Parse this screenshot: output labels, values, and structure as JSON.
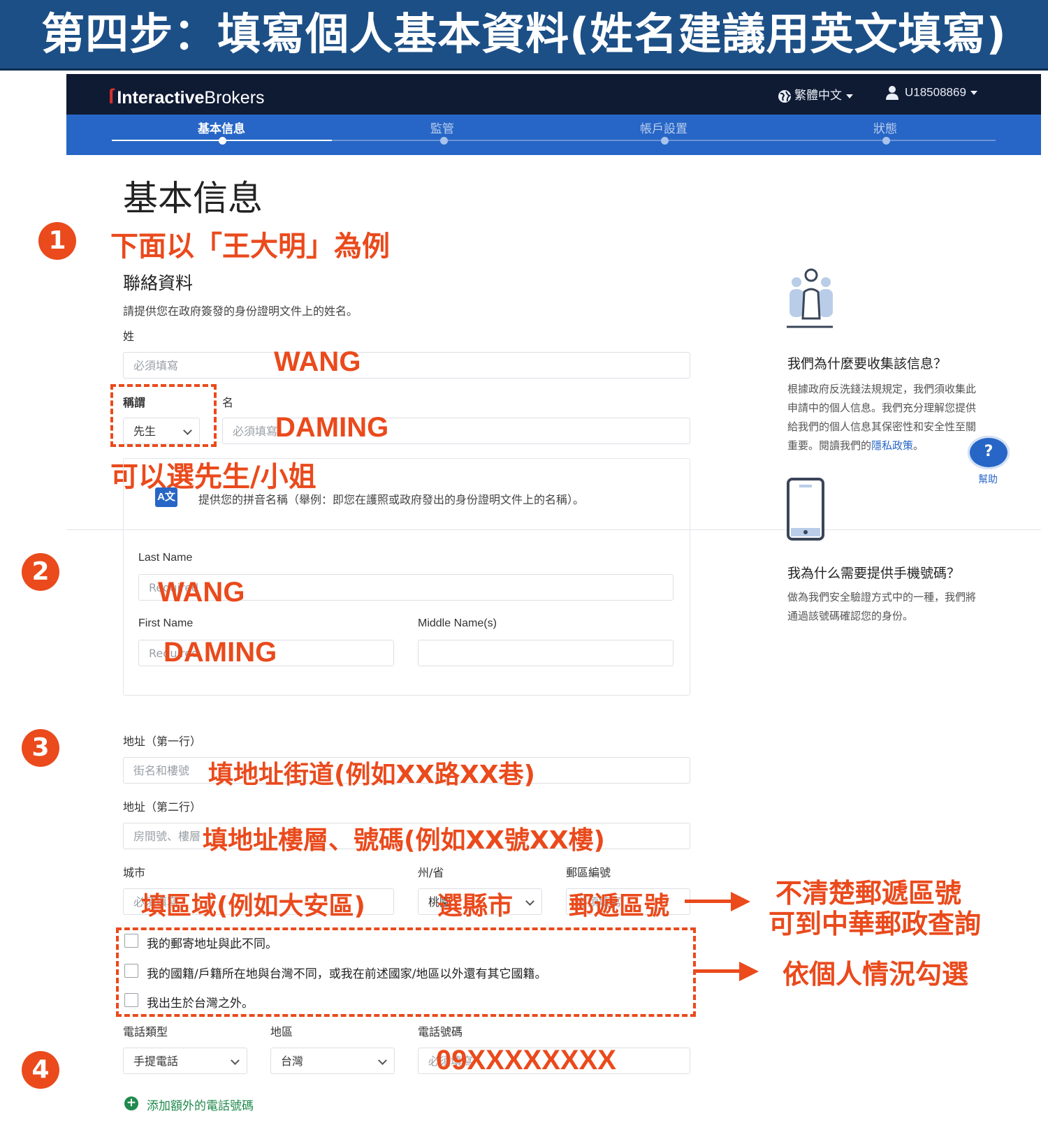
{
  "banner": {
    "title": "第四步：填寫個人基本資料(姓名建議用英文填寫)"
  },
  "header": {
    "logo_text_bold": "Interactive",
    "logo_text_light": "Brokers",
    "language": "繁體中文",
    "user_id": "U18508869"
  },
  "steps": [
    {
      "label": "基本信息",
      "active": true
    },
    {
      "label": "監管",
      "active": false
    },
    {
      "label": "帳戶設置",
      "active": false
    },
    {
      "label": "狀態",
      "active": false
    }
  ],
  "page": {
    "title": "基本信息"
  },
  "annotations": {
    "num1": "1",
    "num2": "2",
    "num3": "3",
    "num4": "4",
    "example_note": "下面以「王大明」為例",
    "surname_value": "WANG",
    "given_value": "DAMING",
    "salutation_note": "可以選先生/小姐",
    "last_name_value": "WANG",
    "first_name_value": "DAMING",
    "street_note": "填地址街道(例如XX路XX巷)",
    "line2_note": "填地址樓層、號碼(例如XX號XX樓)",
    "city_note": "填區域(例如大安區)",
    "state_note": "選縣市",
    "zip_note": "郵遞區號",
    "zip_help_line1": "不清楚郵遞區號",
    "zip_help_line2": "可到中華郵政查詢",
    "checkbox_note": "依個人情況勾選",
    "phone_value": "09XXXXXXXX"
  },
  "contact": {
    "heading": "聯絡資料",
    "description": "請提供您在政府簽發的身份證明文件上的姓名。",
    "surname_label": "姓",
    "surname_placeholder": "必須填寫",
    "salutation_label": "稱謂",
    "salutation_value": "先生",
    "given_label": "名",
    "given_placeholder": "必須填寫",
    "pinyin_note": "提供您的拼音名稱（舉例：即您在護照或政府發出的身份證明文件上的名稱）。",
    "translate_icon_text": "A文",
    "last_name_label": "Last Name",
    "last_name_placeholder": "Required",
    "first_name_label": "First Name",
    "first_name_placeholder": "Required",
    "middle_name_label": "Middle Name(s)"
  },
  "address": {
    "line1_label": "地址（第一行）",
    "line1_placeholder": "街名和樓號",
    "line2_label": "地址（第二行）",
    "line2_placeholder": "房間號、樓層",
    "city_label": "城市",
    "city_placeholder": "必須填寫",
    "state_label": "州/省",
    "state_value": "桃園",
    "zip_label": "郵區編號",
    "zip_placeholder": "必須填寫"
  },
  "checkboxes": [
    {
      "label": "我的郵寄地址與此不同。",
      "checked": false
    },
    {
      "label": "我的國籍/戶籍所在地與台灣不同，或我在前述國家/地區以外還有其它國籍。",
      "checked": false
    },
    {
      "label": "我出生於台灣之外。",
      "checked": false
    }
  ],
  "phone": {
    "type_label": "電話類型",
    "type_value": "手提電話",
    "region_label": "地區",
    "region_value": "台灣",
    "number_label": "電話號碼",
    "number_placeholder": "必須填寫",
    "add_label": "添加額外的電話號碼"
  },
  "sidebar": {
    "why_title": "我們為什麼要收集該信息？",
    "why_text_before_link": "根據政府反洗錢法規規定，我們須收集此申請中的個人信息。我們充分理解您提供給我們的個人信息其保密性和安全性至關重要。閱讀我們的",
    "why_link": "隱私政策",
    "why_text_after_link": "。",
    "phone_title": "我為什么需要提供手機號碼？",
    "phone_text": "做為我們安全驗證方式中的一種，我們將通過該號碼確認您的身份。",
    "help_label": "幫助",
    "help_symbol": "?"
  },
  "colors": {
    "accent_red": "#ea4a1c",
    "ib_blue": "#2766c6",
    "header_navy": "#0f1a33",
    "banner_blue": "#1c4f86"
  },
  "icons": [
    "globe-icon",
    "user-icon",
    "people-icon",
    "phone-device-icon",
    "help-icon",
    "translate-icon",
    "plus-icon",
    "chevron-down-icon"
  ]
}
